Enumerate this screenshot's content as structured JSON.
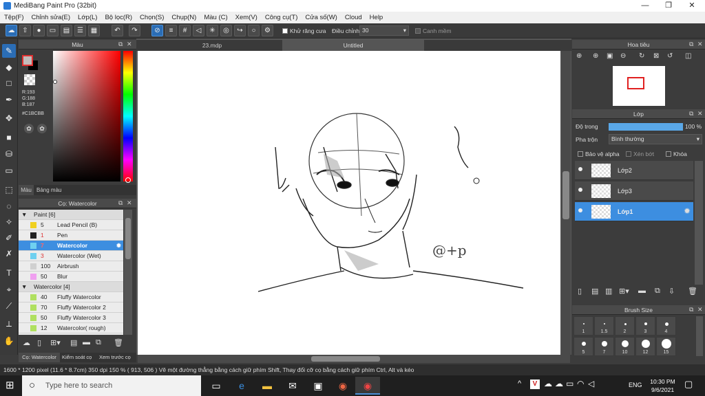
{
  "window": {
    "title": "MediBang Paint Pro (32bit)",
    "minimize": "—",
    "maximize": "❐",
    "close": "✕"
  },
  "menu": [
    "Tệp(F)",
    "Chỉnh sửa(E)",
    "Lớp(L)",
    "Bộ lọc(R)",
    "Chọn(S)",
    "Chụp(N)",
    "Màu (C)",
    "Xem(V)",
    "Công cụ(T)",
    "Cửa số(W)",
    "Cloud",
    "Help"
  ],
  "toolbar": {
    "antialias_label": "Khử răng cưa",
    "adjust_label": "Điều chỉnh",
    "adjust_value": "30",
    "snap_label": "Canh mềm"
  },
  "color_panel": {
    "title": "Màu",
    "r": "R:193",
    "g": "G:188",
    "b": "B:187",
    "hex": "#C1BCBB",
    "tab_color": "Màu",
    "tab_palette": "Bảng màu",
    "fg_color": "#C1BCBB"
  },
  "brush_panel": {
    "title": "Cọ: Watercolor",
    "groups": [
      {
        "name": "Paint [6]",
        "items": [
          {
            "size": "5",
            "name": "Lead Pencil (B)",
            "color": "#f0d020"
          },
          {
            "size": "1",
            "name": "Pen",
            "color": "#222222"
          },
          {
            "size": "7",
            "name": "Watercolor",
            "color": "#6fd0f0",
            "selected": true
          },
          {
            "size": "3",
            "name": "Watercolor (Wet)",
            "color": "#6fd0f0"
          },
          {
            "size": "100",
            "name": "Airbrush",
            "color": "#d0d0d0"
          },
          {
            "size": "50",
            "name": "Blur",
            "color": "#f0a0f0"
          }
        ]
      },
      {
        "name": "Watercolor [4]",
        "items": [
          {
            "size": "40",
            "name": "Fluffy Watercolor",
            "color": "#b0e060"
          },
          {
            "size": "70",
            "name": "Fluffy Watercolor 2",
            "color": "#b0e060"
          },
          {
            "size": "50",
            "name": "Fluffy Watercolor 3",
            "color": "#b0e060"
          },
          {
            "size": "12",
            "name": "Watercolor( rough)",
            "color": "#b0e060"
          }
        ]
      }
    ],
    "bottom_tabs": [
      "Cọ: Watercolor",
      "Kiểm soát cọ",
      "Xem trước cọ"
    ]
  },
  "canvas": {
    "tabs": [
      "23.mdp",
      "Untitled"
    ],
    "signature": "@+p"
  },
  "navigator": {
    "title": "Hoa tiêu"
  },
  "layers": {
    "title": "Lớp",
    "opacity_label": "Độ trong",
    "opacity_value": "100 %",
    "opacity_fraction": 1.0,
    "blend_label": "Pha trộn",
    "blend_value": "Bình thường",
    "protect_alpha": "Bảo vệ alpha",
    "clip": "Xén bớt",
    "lock": "Khóa",
    "items": [
      {
        "name": "Lớp2"
      },
      {
        "name": "Lớp3"
      },
      {
        "name": "Lớp1",
        "selected": true
      }
    ]
  },
  "brush_size": {
    "title": "Brush Size",
    "sizes": [
      "1",
      "1.5",
      "2",
      "3",
      "4",
      "5",
      "7",
      "10",
      "12",
      "15"
    ]
  },
  "status": "1600 * 1200 pixel   (11.6 * 8.7cm)   350 dpi   150 %   ( 913, 506 )   Vẽ một đường thẳng bằng cách giữ phím Shift, Thay đổi cỡ cọ bằng cách giữ phím Ctrl, Alt và kéo",
  "taskbar": {
    "search_placeholder": "Type here to search",
    "lang": "ENG",
    "time": "10:30 PM",
    "date": "9/6/2021"
  }
}
